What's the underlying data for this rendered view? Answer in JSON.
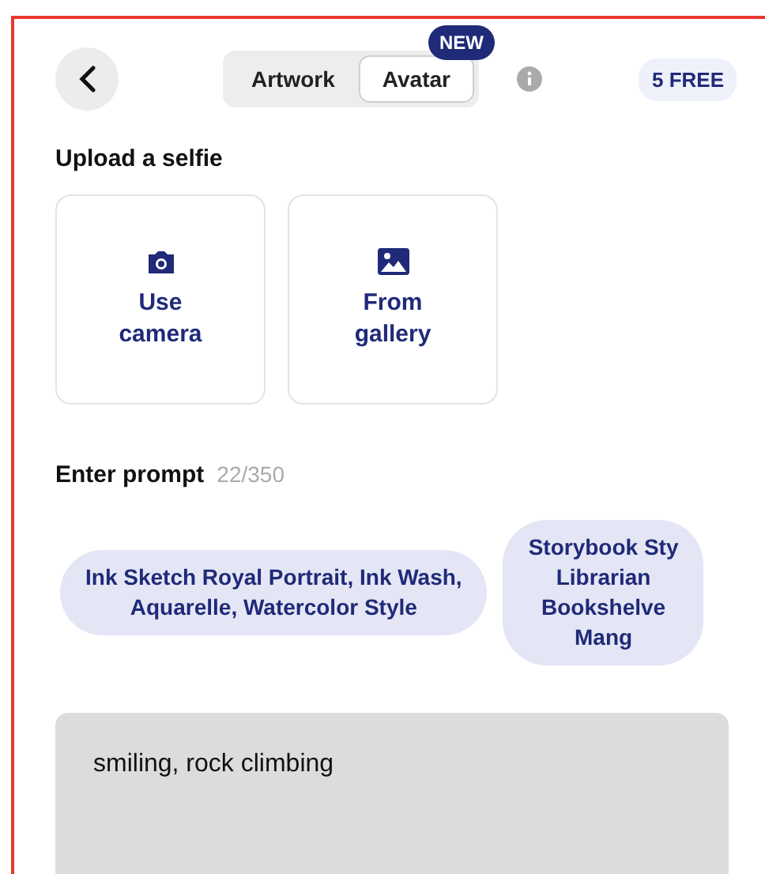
{
  "header": {
    "tabs": [
      {
        "label": "Artwork",
        "selected": false
      },
      {
        "label": "Avatar",
        "selected": true
      }
    ],
    "new_badge": "NEW",
    "credits": "5 FREE"
  },
  "upload": {
    "title": "Upload a selfie",
    "options": [
      {
        "kind": "camera",
        "lines": [
          "Use",
          "camera"
        ]
      },
      {
        "kind": "gallery",
        "lines": [
          "From",
          "gallery"
        ]
      }
    ]
  },
  "prompt": {
    "title": "Enter prompt",
    "counter": "22/350",
    "suggestions": [
      {
        "lines": [
          "Ink Sketch Royal Portrait, Ink Wash,",
          "Aquarelle, Watercolor Style"
        ]
      },
      {
        "lines": [
          "Storybook Sty",
          "Librarian",
          "Bookshelve",
          "Mang"
        ]
      }
    ],
    "value": "smiling, rock climbing"
  }
}
